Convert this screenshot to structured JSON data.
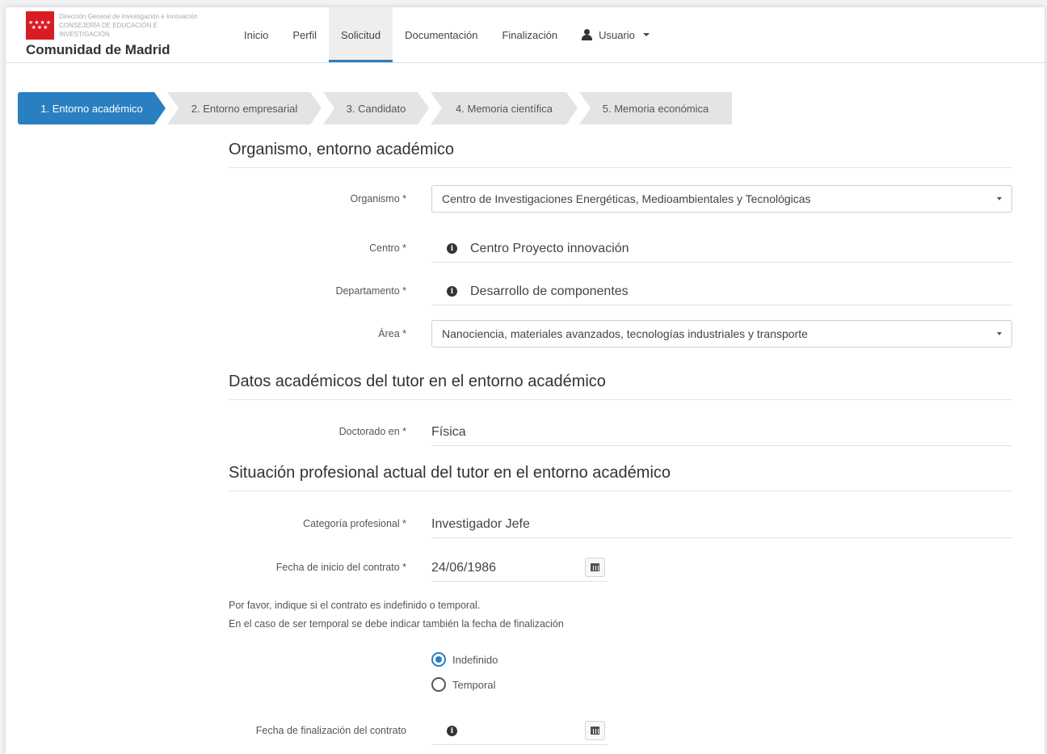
{
  "header": {
    "logo_lines": [
      "Dirección General de Investigación e Innovación",
      "CONSEJERÍA DE EDUCACIÓN E",
      "INVESTIGACIÓN"
    ],
    "brand": "Comunidad de Madrid",
    "nav": [
      "Inicio",
      "Perfil",
      "Solicitud",
      "Documentación",
      "Finalización"
    ],
    "active_nav": "Solicitud",
    "user_label": "Usuario"
  },
  "steps": [
    "1. Entorno académico",
    "2. Entorno empresarial",
    "3. Candidato",
    "4. Memoria científica",
    "5. Memoria económica"
  ],
  "sections": {
    "organismo_title": "Organismo, entorno académico",
    "datos_title": "Datos académicos del tutor en el entorno académico",
    "situacion_title": "Situación profesional actual del tutor en el entorno académico"
  },
  "fields": {
    "organismo": {
      "label": "Organismo *",
      "value": "Centro de Investigaciones Energéticas, Medioambientales y Tecnológicas"
    },
    "centro": {
      "label": "Centro *",
      "value": "Centro Proyecto innovación"
    },
    "departamento": {
      "label": "Departamento *",
      "value": "Desarrollo de componentes"
    },
    "area": {
      "label": "Área *",
      "value": "Nanociencia, materiales avanzados, tecnologías industriales y transporte"
    },
    "doctorado": {
      "label": "Doctorado en *",
      "value": "Física"
    },
    "categoria": {
      "label": "Categoría profesional *",
      "value": "Investigador Jefe"
    },
    "fecha_inicio": {
      "label": "Fecha de inicio del contrato *",
      "value": "24/06/1986"
    },
    "fecha_fin": {
      "label": "Fecha de finalización del contrato",
      "value": ""
    }
  },
  "notes": {
    "line1": "Por favor, indique si el contrato es indefinido o temporal.",
    "line2": "En el caso de ser temporal se debe indicar también la fecha de finalización"
  },
  "contract_type": {
    "options": [
      "Indefinido",
      "Temporal"
    ],
    "selected": "Indefinido"
  },
  "colors": {
    "accent": "#2a7fc1",
    "brand_red": "#d91c24"
  }
}
